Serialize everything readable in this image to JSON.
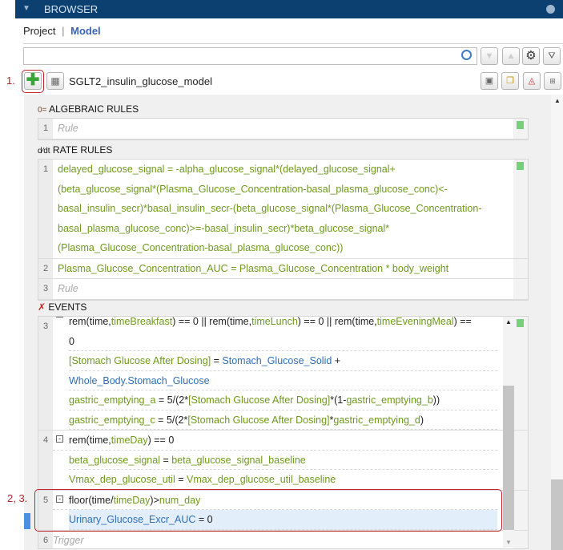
{
  "header": {
    "title": "BROWSER"
  },
  "tabs": {
    "project": "Project",
    "sep": "|",
    "model": "Model"
  },
  "search": {
    "value": "",
    "placeholder": ""
  },
  "model": {
    "name": "SGLT2_insulin_glucose_model"
  },
  "annotations": {
    "a1": "1.",
    "a23": "2, 3."
  },
  "algebraic": {
    "title": "ALGEBRAIC RULES",
    "icon": "0=",
    "rows": [
      {
        "n": "1",
        "placeholder": "Rule"
      }
    ]
  },
  "rate": {
    "title": "RATE RULES",
    "rows": [
      {
        "n": "1",
        "lines": [
          [
            [
              "delayed_glucose_signal = -alpha_glucose_signal*(delayed_glucose_signal+",
              "g"
            ]
          ],
          [
            [
              "(beta_glucose_signal*(Plasma_Glucose_Concentration-basal_plasma_glucose_conc)<-",
              "g"
            ]
          ],
          [
            [
              "basal_insulin_secr)*basal_insulin_secr-(beta_glucose_signal*(Plasma_Glucose_Concentration-",
              "g"
            ]
          ],
          [
            [
              "basal_plasma_glucose_conc)>=-basal_insulin_secr)*beta_glucose_signal*",
              "g"
            ]
          ],
          [
            [
              "(Plasma_Glucose_Concentration-basal_plasma_glucose_conc))",
              "g"
            ]
          ]
        ]
      },
      {
        "n": "2",
        "lines": [
          [
            [
              "Plasma_Glucose_Concentration_AUC = Plasma_Glucose_Concentration * body_weight",
              "g"
            ]
          ]
        ]
      },
      {
        "n": "3",
        "placeholder": "Rule"
      }
    ]
  },
  "events": {
    "title": "EVENTS",
    "rows": [
      {
        "n": "3",
        "lines": [
          [
            [
              "rem(time,",
              "k"
            ],
            [
              "timeBreakfast",
              "g"
            ],
            [
              ") == 0 || rem(time,",
              "k"
            ],
            [
              "timeLunch",
              "g"
            ],
            [
              ") == 0 || rem(time,",
              "k"
            ],
            [
              "timeEveningMeal",
              "g"
            ],
            [
              ") ==",
              "k"
            ]
          ],
          [
            [
              "0",
              "k"
            ]
          ],
          [
            [
              "[Stomach Glucose After Dosing]",
              "g"
            ],
            [
              " = ",
              "k"
            ],
            [
              "Stomach_Glucose_Solid",
              "b"
            ],
            [
              " +",
              "k"
            ]
          ],
          [
            [
              "Whole_Body.Stomach_Glucose",
              "b"
            ]
          ],
          [
            [
              "gastric_emptying_a",
              "g"
            ],
            [
              " = 5/(2*",
              "k"
            ],
            [
              "[Stomach Glucose After Dosing]",
              "g"
            ],
            [
              "*(1-",
              "k"
            ],
            [
              "gastric_emptying_b",
              "g"
            ],
            [
              "))",
              "k"
            ]
          ],
          [
            [
              "gastric_emptying_c",
              "g"
            ],
            [
              " = 5/(2*",
              "k"
            ],
            [
              "[Stomach Glucose After Dosing]",
              "g"
            ],
            [
              "*",
              "k"
            ],
            [
              "gastric_emptying_d",
              "g"
            ],
            [
              ")",
              "k"
            ]
          ]
        ]
      },
      {
        "n": "4",
        "lines": [
          [
            [
              "rem(time,",
              "k"
            ],
            [
              "timeDay",
              "g"
            ],
            [
              ") == 0",
              "k"
            ]
          ],
          [
            [
              "beta_glucose_signal",
              "g"
            ],
            [
              " = ",
              "k"
            ],
            [
              "beta_glucose_signal_baseline",
              "g"
            ]
          ],
          [
            [
              "Vmax_dep_glucose_util",
              "g"
            ],
            [
              " = ",
              "k"
            ],
            [
              "Vmax_dep_glucose_util_baseline",
              "g"
            ]
          ]
        ]
      },
      {
        "n": "5",
        "lines": [
          [
            [
              "floor(time/",
              "k"
            ],
            [
              "timeDay",
              "g"
            ],
            [
              ")>",
              "k"
            ],
            [
              "num_day",
              "g"
            ]
          ],
          [
            [
              "Urinary_Glucose_Excr_AUC",
              "b"
            ],
            [
              " = 0",
              "k"
            ]
          ]
        ]
      },
      {
        "n": "6",
        "placeholder": "Trigger"
      }
    ]
  },
  "colors": {
    "header": "#0b4070",
    "green": "#6e9a1c",
    "blue": "#2f6fb8",
    "annotation": "#c0262d",
    "selected": "#e3eefb"
  }
}
